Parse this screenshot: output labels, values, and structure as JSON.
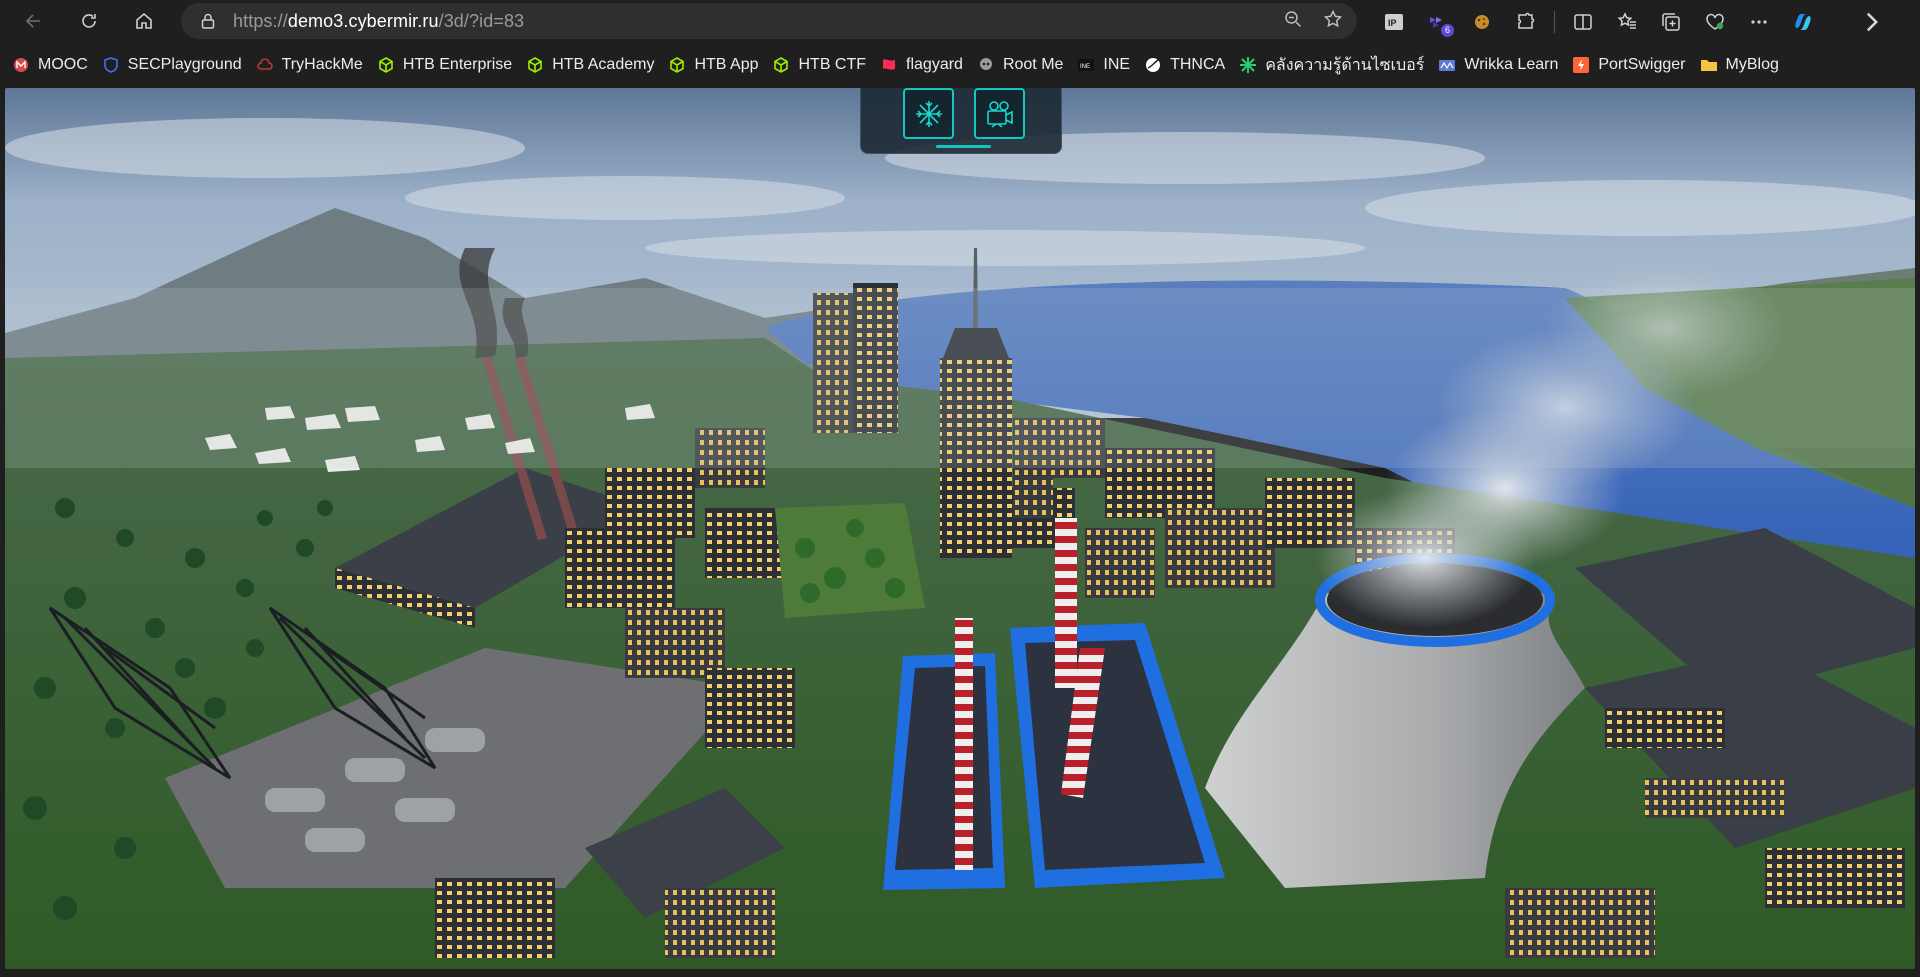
{
  "browser": {
    "url_scheme": "https://",
    "url_host": "demo3.cybermir.ru",
    "url_path": "/3d/?id=83",
    "extension_badge": "6"
  },
  "bookmarks": [
    {
      "label": "MOOC",
      "icon": "mooc-icon",
      "color": "#d94b4b"
    },
    {
      "label": "SECPlayground",
      "icon": "shield-icon",
      "color": "#4a6cf0"
    },
    {
      "label": "TryHackMe",
      "icon": "cloud-icon",
      "color": "#c0392b"
    },
    {
      "label": "HTB Enterprise",
      "icon": "cube-icon",
      "color": "#9fef00"
    },
    {
      "label": "HTB Academy",
      "icon": "cube-icon",
      "color": "#9fef00"
    },
    {
      "label": "HTB App",
      "icon": "cube-icon",
      "color": "#9fef00"
    },
    {
      "label": "HTB CTF",
      "icon": "cube-icon",
      "color": "#9fef00"
    },
    {
      "label": "flagyard",
      "icon": "flag-icon",
      "color": "#ff2d55"
    },
    {
      "label": "Root Me",
      "icon": "skull-icon",
      "color": "#9a9a9a"
    },
    {
      "label": "INE",
      "icon": "ine-icon",
      "color": "#ffffff"
    },
    {
      "label": "THNCA",
      "icon": "thnca-icon",
      "color": "#ffffff"
    },
    {
      "label": "คลังความรู้ด้านไซเบอร์",
      "icon": "star-burst-icon",
      "color": "#2ecc71"
    },
    {
      "label": "Wrikka Learn",
      "icon": "wrikka-icon",
      "color": "#5b7bd5"
    },
    {
      "label": "PortSwigger",
      "icon": "bolt-icon",
      "color": "#ff6633"
    },
    {
      "label": "MyBlog",
      "icon": "folder-icon",
      "color": "#f5c542"
    }
  ],
  "scene": {
    "sky_color": "#8aa2c0",
    "water_color": "#3d6fc4",
    "grass_color": "#3b6b32",
    "accent_blue": "#1f6fe0"
  },
  "scene_panel": {
    "buttons": [
      {
        "name": "snowflake-view-button",
        "icon": "snowflake-icon"
      },
      {
        "name": "camera-view-button",
        "icon": "video-camera-icon"
      }
    ],
    "accent_color": "#14c7be"
  }
}
